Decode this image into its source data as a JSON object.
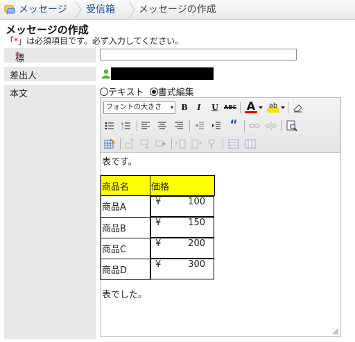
{
  "breadcrumb": {
    "home": "メッセージ",
    "inbox": "受信箱",
    "current": "メッセージの作成"
  },
  "page_title": "メッセージの作成",
  "required_note": {
    "prefix": "「",
    "star": "*",
    "suffix": "」は必須項目です。必ず入力してください。"
  },
  "fields": {
    "subject_label": "標題",
    "subject_required": "*",
    "subject_value": "",
    "sender_label": "差出人",
    "body_label": "本文"
  },
  "format": {
    "text_option": "テキスト",
    "rich_option": "書式編集",
    "selected": "rich"
  },
  "toolbar": {
    "font_size": "フォントの大きさ",
    "font_size_arrow": "▾",
    "bold": "B",
    "italic": "I",
    "underline": "U",
    "strike": "ABC",
    "color": "A",
    "highlight": "ab",
    "blockquote": "“"
  },
  "editor": {
    "intro": "表です。",
    "outro": "表でした。",
    "table": {
      "headers": [
        "商品名",
        "価格"
      ],
      "rows": [
        [
          "商品A",
          "¥",
          "100"
        ],
        [
          "商品B",
          "¥",
          "150"
        ],
        [
          "商品C",
          "¥",
          "200"
        ],
        [
          "商品D",
          "¥",
          "300"
        ]
      ]
    }
  },
  "colors": {
    "link": "#1a4e9a",
    "required": "#dd0000",
    "table_header": "#ffff00",
    "label_bg": "#e8e8e8"
  }
}
